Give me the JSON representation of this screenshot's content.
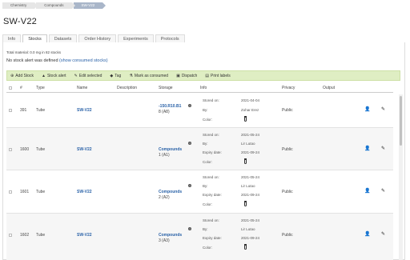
{
  "breadcrumb": [
    "Chemistry",
    "Compounds",
    "SW-V22"
  ],
  "page_title": "SW-V22",
  "tabs": [
    "Info",
    "Stocks",
    "Datasets",
    "Order History",
    "Experiments",
    "Protocols"
  ],
  "active_tab": "Stocks",
  "total_material": "Total material: 0.0 mg in 82 stocks",
  "alert_text": "No stock alert was defined",
  "show_consumed_link": "(show consumed stocks)",
  "toolbar": {
    "add_stock": "Add Stock",
    "stock_alert": "Stock alert",
    "edit_selected": "Edit selected",
    "tag": "Tag",
    "mark_consumed": "Mark as consumed",
    "dispatch": "Dispatch",
    "print_labels": "Print labels"
  },
  "columns": [
    "#",
    "Type",
    "Name",
    "Description",
    "Storage",
    "Info",
    "Privacy",
    "Output"
  ],
  "info_labels": {
    "stored_on": "Stored on:",
    "by": "By:",
    "color": "Color:",
    "expiry": "Expiry date:"
  },
  "rows": [
    {
      "num": "391",
      "type": "Tube",
      "name": "SW-V22",
      "storage_main": "-150.R10.B1",
      "storage_sub": "8 (A8)",
      "stored_on": "2021-04-04",
      "by": "Zohar Erez",
      "expiry": "",
      "privacy": "Public"
    },
    {
      "num": "1600",
      "type": "Tube",
      "name": "SW-V22",
      "storage_main": "Compounds",
      "storage_sub": "1 (A1)",
      "stored_on": "2021-05-24",
      "by": "Lir Lutao",
      "expiry": "2021-09-24",
      "privacy": "Public"
    },
    {
      "num": "1601",
      "type": "Tube",
      "name": "SW-V22",
      "storage_main": "Compounds",
      "storage_sub": "2 (A2)",
      "stored_on": "2021-05-24",
      "by": "Lir Lutao",
      "expiry": "2021-09-24",
      "privacy": "Public"
    },
    {
      "num": "1602",
      "type": "Tube",
      "name": "SW-V22",
      "storage_main": "Compounds",
      "storage_sub": "3 (A3)",
      "stored_on": "2021-05-24",
      "by": "Lir Lutao",
      "expiry": "2021-09-24",
      "privacy": "Public"
    }
  ]
}
